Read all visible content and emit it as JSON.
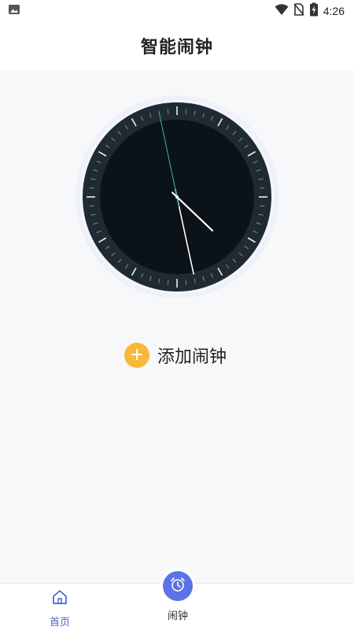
{
  "status_bar": {
    "time": "4:26",
    "icons": [
      "image-icon",
      "wifi-icon",
      "no-sim-icon",
      "battery-charging-icon"
    ]
  },
  "header": {
    "title": "智能闹钟"
  },
  "clock": {
    "time_shown": {
      "hour": 4,
      "minute": 27,
      "second": 58
    },
    "colors": {
      "face": "#0b1218",
      "rim": "#1f2a33",
      "bezel": "#e9eef6",
      "second_hand": "#3fa3a8",
      "hand": "#ffffff"
    }
  },
  "add_alarm": {
    "label": "添加闹钟",
    "icon": "plus-icon",
    "color": "#f6b93b"
  },
  "bottom_nav": {
    "items": [
      {
        "label": "首页",
        "icon": "home-icon"
      },
      {
        "label": "闹钟",
        "icon": "alarm-clock-icon"
      }
    ],
    "accent": "#5b73e6"
  }
}
